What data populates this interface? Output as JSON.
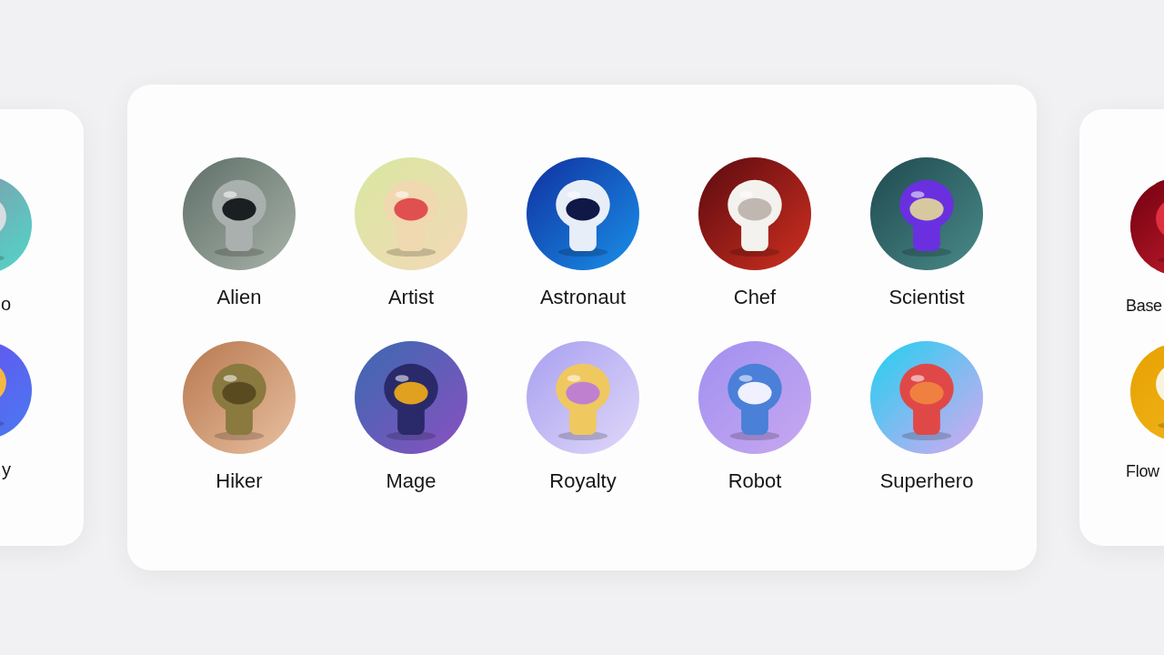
{
  "carousel": {
    "cards": [
      {
        "kind": "previous",
        "items": [
          {
            "label": "o"
          },
          {
            "label": "y"
          }
        ]
      },
      {
        "kind": "current",
        "items": [
          {
            "label": "Alien"
          },
          {
            "label": "Artist"
          },
          {
            "label": "Astronaut"
          },
          {
            "label": "Chef"
          },
          {
            "label": "Scientist"
          },
          {
            "label": "Hiker"
          },
          {
            "label": "Mage"
          },
          {
            "label": "Royalty"
          },
          {
            "label": "Robot"
          },
          {
            "label": "Superhero"
          }
        ]
      },
      {
        "kind": "next",
        "items": [
          {
            "label": "Base"
          },
          {
            "label": "Flow"
          }
        ]
      }
    ]
  }
}
